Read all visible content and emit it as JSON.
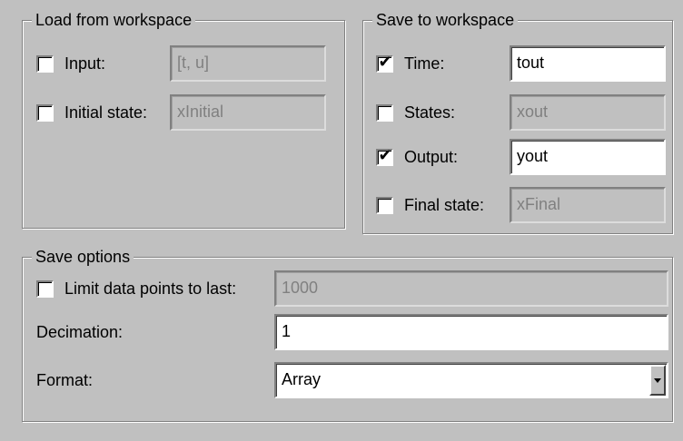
{
  "load_group": {
    "title": "Load from workspace",
    "input": {
      "label": "Input:",
      "checked": false,
      "value": "[t, u]"
    },
    "initial_state": {
      "label": "Initial state:",
      "checked": false,
      "value": "xInitial"
    }
  },
  "save_group": {
    "title": "Save to workspace",
    "time": {
      "label": "Time:",
      "checked": true,
      "value": "tout"
    },
    "states": {
      "label": "States:",
      "checked": false,
      "value": "xout"
    },
    "output": {
      "label": "Output:",
      "checked": true,
      "value": "yout"
    },
    "final_state": {
      "label": "Final state:",
      "checked": false,
      "value": "xFinal"
    }
  },
  "options_group": {
    "title": "Save options",
    "limit": {
      "label": "Limit data points to last:",
      "checked": false,
      "value": "1000"
    },
    "decimation": {
      "label": "Decimation:",
      "value": "1"
    },
    "format": {
      "label": "Format:",
      "value": "Array"
    }
  },
  "check_glyph": "✔"
}
